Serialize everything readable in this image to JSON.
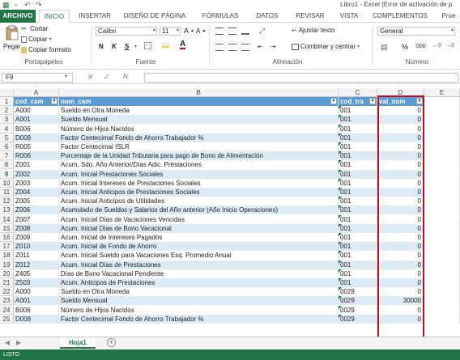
{
  "window": {
    "title": "Libro1 - Excel (Error de activación de p"
  },
  "tabs": [
    "ARCHIVO",
    "INICIO",
    "INSERTAR",
    "DISEÑO DE PÁGINA",
    "FÓRMULAS",
    "DATOS",
    "REVISAR",
    "VISTA",
    "COMPLEMENTOS",
    "Prue"
  ],
  "ribbon": {
    "paste": "Pegar",
    "cut": "Cortar",
    "copy": "Copiar",
    "format_painter": "Copiar formato",
    "font_name": "Calibri",
    "font_size": "11",
    "bold": "N",
    "italic": "K",
    "underline": "S",
    "wrap_text": "Ajustar texto",
    "merge_center": "Combinar y centrar",
    "number_format": "General",
    "groups": {
      "clipboard": "Portapapeles",
      "font": "Fuente",
      "alignment": "Alineación",
      "number": "Número"
    }
  },
  "formula_bar": {
    "name_box": "F9",
    "fx": "fx",
    "value": ""
  },
  "columns": [
    "A",
    "B",
    "C",
    "D",
    "E"
  ],
  "header_row": {
    "a": "cod_cam",
    "b": "nom_cam",
    "c": "cod_tra",
    "d": "val_num"
  },
  "rows": [
    {
      "r": "2",
      "a": "A000",
      "b": "Sueldo en Otra Moneda",
      "c": "001",
      "d": "0"
    },
    {
      "r": "3",
      "a": "A001",
      "b": "Sueldo Mensual",
      "c": "001",
      "d": "0"
    },
    {
      "r": "4",
      "a": "B006",
      "b": "Número de Hijos Nacidos",
      "c": "001",
      "d": "0"
    },
    {
      "r": "5",
      "a": "D008",
      "b": "Factor Centecimal Fondo de Ahorro Trabajador %",
      "c": "001",
      "d": "0"
    },
    {
      "r": "6",
      "a": "R005",
      "b": "Factor Centecimal ISLR",
      "c": "001",
      "d": "0"
    },
    {
      "r": "7",
      "a": "R006",
      "b": "Porcentaje de la Unidad Tributaria para pago de Bono de Alimentación",
      "c": "001",
      "d": "0"
    },
    {
      "r": "8",
      "a": "Z001",
      "b": "Acum. Sdo. Año Anterior/Días Adic. Préstaciones",
      "c": "001",
      "d": "0"
    },
    {
      "r": "9",
      "a": "Z002",
      "b": "Acum. Inicial Prestaciones Sociales",
      "c": "001",
      "d": "0"
    },
    {
      "r": "10",
      "a": "Z003",
      "b": "Acum. Inicial Intereses de Prestaciones Sociales",
      "c": "001",
      "d": "0"
    },
    {
      "r": "11",
      "a": "Z004",
      "b": "Acum. Inicial Anticipos de Prestaciones Sociales",
      "c": "001",
      "d": "0"
    },
    {
      "r": "12",
      "a": "Z005",
      "b": "Acum. Inicial Anticipos de Utilidades",
      "c": "001",
      "d": "0"
    },
    {
      "r": "13",
      "a": "Z006",
      "b": "Acumulado de Sueldos y Salarios del Año anterior (Año Inicio Operaciones)",
      "c": "001",
      "d": "0"
    },
    {
      "r": "14",
      "a": "Z007",
      "b": "Acum. Inicial Días de Vacaciones Vencidas",
      "c": "001",
      "d": "0"
    },
    {
      "r": "15",
      "a": "Z008",
      "b": "Acum.  Inicial Días de Bono Vacacional",
      "c": "001",
      "d": "0"
    },
    {
      "r": "16",
      "a": "Z009",
      "b": "Acum. Inicial de Intereses Pagados",
      "c": "001",
      "d": "0"
    },
    {
      "r": "17",
      "a": "Z010",
      "b": "Acum. Inicial de Fondo de Ahorro",
      "c": "001",
      "d": "0"
    },
    {
      "r": "18",
      "a": "Z011",
      "b": "Acum. Inicial Sueldo para Vacaciones Esq. Promedio Anual",
      "c": "001",
      "d": "0"
    },
    {
      "r": "19",
      "a": "Z012",
      "b": "Acum. Inicial Días de Prestaciones",
      "c": "001",
      "d": "0"
    },
    {
      "r": "20",
      "a": "Z405",
      "b": "Días de Bono Vacacional Pendiente",
      "c": "001",
      "d": "0"
    },
    {
      "r": "21",
      "a": "Z503",
      "b": "Acum. Anticipos de Prestaciones",
      "c": "001",
      "d": "0"
    },
    {
      "r": "22",
      "a": "A000",
      "b": "Sueldo en Otra Moneda",
      "c": "0029",
      "d": "0"
    },
    {
      "r": "23",
      "a": "A001",
      "b": "Sueldo Mensual",
      "c": "0029",
      "d": "30000"
    },
    {
      "r": "24",
      "a": "B006",
      "b": "Número de Hijos Nacidos",
      "c": "0029",
      "d": "0"
    },
    {
      "r": "25",
      "a": "D008",
      "b": "Factor Centecimal Fondo de Ahorro Trabajador %",
      "c": "0029",
      "d": "0"
    }
  ],
  "sheet_tabs": {
    "active": "Hoja1"
  },
  "status": {
    "text": "LISTO"
  },
  "colors": {
    "excel_green": "#217346",
    "table_header": "#5b9bd5",
    "band": "#ddebf7",
    "highlight_box": "#b8121f"
  }
}
